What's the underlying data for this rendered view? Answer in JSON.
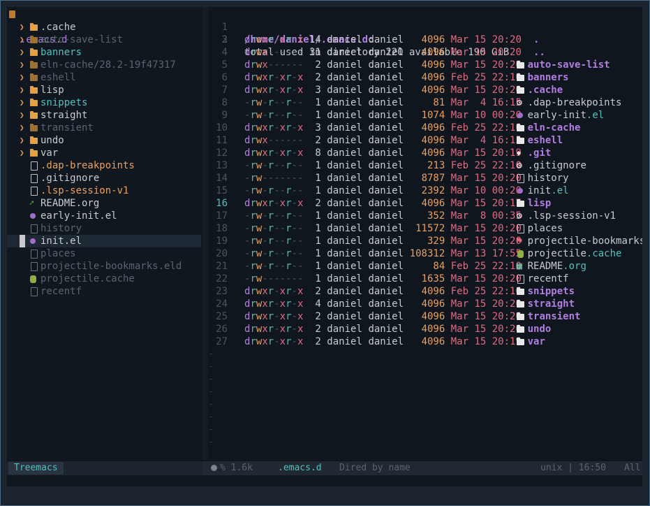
{
  "treemacs": {
    "root": ".emacs.d",
    "items": [
      {
        "name": ".cache",
        "type": "folder",
        "dim": false,
        "color": "#c8ccd0"
      },
      {
        "name": "auto-save-list",
        "type": "folder",
        "dim": true,
        "color": "#5a6470"
      },
      {
        "name": "banners",
        "type": "folder",
        "dim": false,
        "color": "#4fc1c0"
      },
      {
        "name": "eln-cache/28.2-19f47317",
        "type": "folder",
        "dim": true,
        "color": "#5a6470"
      },
      {
        "name": "eshell",
        "type": "folder",
        "dim": true,
        "color": "#5a6470"
      },
      {
        "name": "lisp",
        "type": "folder",
        "dim": false,
        "color": "#c8ccd0"
      },
      {
        "name": "snippets",
        "type": "folder",
        "dim": false,
        "color": "#4fc1c0"
      },
      {
        "name": "straight",
        "type": "folder",
        "dim": false,
        "color": "#c8ccd0"
      },
      {
        "name": "transient",
        "type": "folder",
        "dim": true,
        "color": "#5a6470"
      },
      {
        "name": "undo",
        "type": "folder",
        "dim": false,
        "color": "#c8ccd0"
      },
      {
        "name": "var",
        "type": "folder",
        "dim": false,
        "color": "#c8ccd0"
      },
      {
        "name": ".dap-breakpoints",
        "type": "file",
        "dim": false,
        "color": "#e8a060"
      },
      {
        "name": ".gitignore",
        "type": "file",
        "dim": false,
        "color": "#c8ccd0"
      },
      {
        "name": ".lsp-session-v1",
        "type": "file",
        "dim": false,
        "color": "#e8a060"
      },
      {
        "name": "README.org",
        "type": "org",
        "dim": false,
        "color": "#c8ccd0"
      },
      {
        "name": "early-init.el",
        "type": "elisp",
        "dim": false,
        "color": "#c8ccd0"
      },
      {
        "name": "history",
        "type": "file",
        "dim": true,
        "color": "#5a6470"
      },
      {
        "name": "init.el",
        "type": "elisp",
        "dim": false,
        "color": "#c8ccd0",
        "selected": true
      },
      {
        "name": "places",
        "type": "file",
        "dim": true,
        "color": "#5a6470"
      },
      {
        "name": "projectile-bookmarks.eld",
        "type": "file",
        "dim": true,
        "color": "#5a6470"
      },
      {
        "name": "projectile.cache",
        "type": "db",
        "dim": true,
        "color": "#5a6470"
      },
      {
        "name": "recentf",
        "type": "file",
        "dim": true,
        "color": "#5a6470"
      }
    ]
  },
  "dired": {
    "header": "/home/daniel/.emacs.d:",
    "summary": "total used in directory 220 available 190 GiB",
    "current_line": 16,
    "rows": [
      {
        "perm": "drwxr-xr-x",
        "links": "14",
        "owner": "daniel",
        "group": "daniel",
        "size": "4096",
        "date": "Mar 15 20:20",
        "name": ".",
        "kind": "dot"
      },
      {
        "perm": "drwx------",
        "links": "31",
        "owner": "daniel",
        "group": "daniel",
        "size": "4096",
        "date": "Mar 15 20:20",
        "name": "..",
        "kind": "dot"
      },
      {
        "perm": "drwx------",
        "links": "2",
        "owner": "daniel",
        "group": "daniel",
        "size": "4096",
        "date": "Mar 15 20:20",
        "name": "auto-save-list",
        "kind": "dir"
      },
      {
        "perm": "drwxr-xr-x",
        "links": "2",
        "owner": "daniel",
        "group": "daniel",
        "size": "4096",
        "date": "Feb 25 22:10",
        "name": "banners",
        "kind": "dir"
      },
      {
        "perm": "drwxr-xr-x",
        "links": "3",
        "owner": "daniel",
        "group": "daniel",
        "size": "4096",
        "date": "Mar 15 20:20",
        "name": ".cache",
        "kind": "dir"
      },
      {
        "perm": "-rw-r--r--",
        "links": "1",
        "owner": "daniel",
        "group": "daniel",
        "size": "81",
        "date": "Mar  4 16:15",
        "name": ".dap-breakpoints",
        "kind": "gear"
      },
      {
        "perm": "-rw-r--r--",
        "links": "1",
        "owner": "daniel",
        "group": "daniel",
        "size": "1074",
        "date": "Mar 10 00:20",
        "name": "early-init",
        "ext": ".el",
        "kind": "elisp"
      },
      {
        "perm": "drwxr-xr-x",
        "links": "3",
        "owner": "daniel",
        "group": "daniel",
        "size": "4096",
        "date": "Feb 25 22:10",
        "name": "eln-cache",
        "kind": "dir"
      },
      {
        "perm": "drwx------",
        "links": "2",
        "owner": "daniel",
        "group": "daniel",
        "size": "4096",
        "date": "Mar  4 16:15",
        "name": "eshell",
        "kind": "dir"
      },
      {
        "perm": "drwxr-xr-x",
        "links": "8",
        "owner": "daniel",
        "group": "daniel",
        "size": "4096",
        "date": "Mar 15 20:19",
        "name": ".git",
        "kind": "git"
      },
      {
        "perm": "-rw-r--r--",
        "links": "1",
        "owner": "daniel",
        "group": "daniel",
        "size": "213",
        "date": "Feb 25 22:10",
        "name": ".gitignore",
        "kind": "gear"
      },
      {
        "perm": "-rw-------",
        "links": "1",
        "owner": "daniel",
        "group": "daniel",
        "size": "8787",
        "date": "Mar 15 20:20",
        "name": "history",
        "kind": "file"
      },
      {
        "perm": "-rw-r--r--",
        "links": "1",
        "owner": "daniel",
        "group": "daniel",
        "size": "2392",
        "date": "Mar 10 00:20",
        "name": "init",
        "ext": ".el",
        "kind": "elisp"
      },
      {
        "perm": "drwxr-xr-x",
        "links": "2",
        "owner": "daniel",
        "group": "daniel",
        "size": "4096",
        "date": "Mar 15 20:17",
        "name": "lisp",
        "kind": "dir"
      },
      {
        "perm": "-rw-r--r--",
        "links": "1",
        "owner": "daniel",
        "group": "daniel",
        "size": "352",
        "date": "Mar  8 00:35",
        "name": ".lsp-session-v1",
        "kind": "gear"
      },
      {
        "perm": "-rw-r--r--",
        "links": "1",
        "owner": "daniel",
        "group": "daniel",
        "size": "11572",
        "date": "Mar 15 20:20",
        "name": "places",
        "kind": "file"
      },
      {
        "perm": "-rw-r--r--",
        "links": "1",
        "owner": "daniel",
        "group": "daniel",
        "size": "329",
        "date": "Mar 15 20:20",
        "name": "projectile-bookmarks.$",
        "kind": "bookmark"
      },
      {
        "perm": "-rw-r--r--",
        "links": "1",
        "owner": "daniel",
        "group": "daniel",
        "size": "108312",
        "date": "Mar 13 17:55",
        "name": "projectile",
        "ext": ".cache",
        "kind": "db"
      },
      {
        "perm": "-rw-r--r--",
        "links": "1",
        "owner": "daniel",
        "group": "daniel",
        "size": "84",
        "date": "Feb 25 22:10",
        "name": "README",
        "ext": ".org",
        "kind": "org"
      },
      {
        "perm": "-rw-------",
        "links": "1",
        "owner": "daniel",
        "group": "daniel",
        "size": "1635",
        "date": "Mar 15 20:20",
        "name": "recentf",
        "kind": "file"
      },
      {
        "perm": "drwxr-xr-x",
        "links": "2",
        "owner": "daniel",
        "group": "daniel",
        "size": "4096",
        "date": "Feb 25 22:16",
        "name": "snippets",
        "kind": "dir"
      },
      {
        "perm": "drwxr-xr-x",
        "links": "4",
        "owner": "daniel",
        "group": "daniel",
        "size": "4096",
        "date": "Mar 15 20:20",
        "name": "straight",
        "kind": "dir"
      },
      {
        "perm": "drwxr-xr-x",
        "links": "2",
        "owner": "daniel",
        "group": "daniel",
        "size": "4096",
        "date": "Mar 15 20:20",
        "name": "transient",
        "kind": "dir"
      },
      {
        "perm": "drwxr-xr-x",
        "links": "2",
        "owner": "daniel",
        "group": "daniel",
        "size": "4096",
        "date": "Mar 15 20:20",
        "name": "undo",
        "kind": "dir"
      },
      {
        "perm": "drwxr-xr-x",
        "links": "2",
        "owner": "daniel",
        "group": "daniel",
        "size": "4096",
        "date": "Mar 15 20:19",
        "name": "var",
        "kind": "dir"
      }
    ]
  },
  "modeline": {
    "treemacs_tab": "Treemacs",
    "percent": "% 1.6k",
    "buffer": ".emacs.d",
    "mode": "Dired by name",
    "encoding": "unix | 16:50",
    "position": "All"
  },
  "colors": {
    "purple": "#b07ee0",
    "cyan": "#4fc1c0",
    "orange": "#e8a060",
    "pink": "#e06a82",
    "gray": "#5a6470"
  }
}
